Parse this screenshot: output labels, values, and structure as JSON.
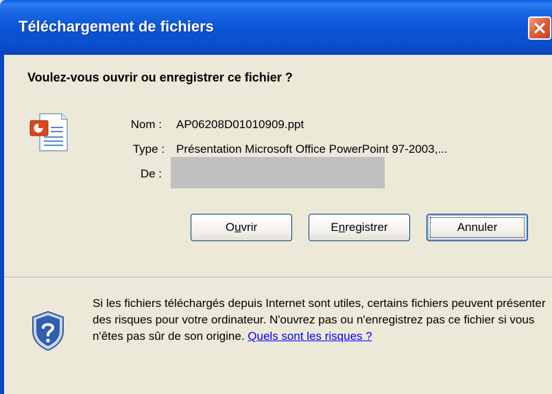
{
  "window": {
    "title": "Téléchargement de fichiers",
    "close_label": "✕"
  },
  "prompt": {
    "question": "Voulez-vous ouvrir ou enregistrer ce fichier ?"
  },
  "file": {
    "icon": "powerpoint-file-icon",
    "name_label": "Nom :",
    "name_value": "AP06208D01010909.ppt",
    "type_label": "Type :",
    "type_value": "Présentation Microsoft Office PowerPoint 97-2003,...",
    "from_label": "De :",
    "from_value": ""
  },
  "buttons": {
    "open_label": "Ouvrir",
    "open_pre": "O",
    "open_accel": "u",
    "open_post": "vrir",
    "save_label": "Enregistrer",
    "save_pre": "E",
    "save_accel": "n",
    "save_post": "registrer",
    "cancel_label": "Annuler"
  },
  "warning": {
    "icon": "security-shield-icon",
    "text": "Si les fichiers téléchargés depuis Internet sont utiles, certains fichiers peuvent présenter des risques pour votre ordinateur. N'ouvrez pas ou n'enregistrez pas ce fichier si vous n'êtes pas sûr de son origine. ",
    "link_text": "Quels sont les risques ?"
  },
  "colors": {
    "titlebar": "#0a55d6",
    "dialog_bg": "#ece9d8",
    "close_button": "#e0603a",
    "link": "#0000ff"
  }
}
